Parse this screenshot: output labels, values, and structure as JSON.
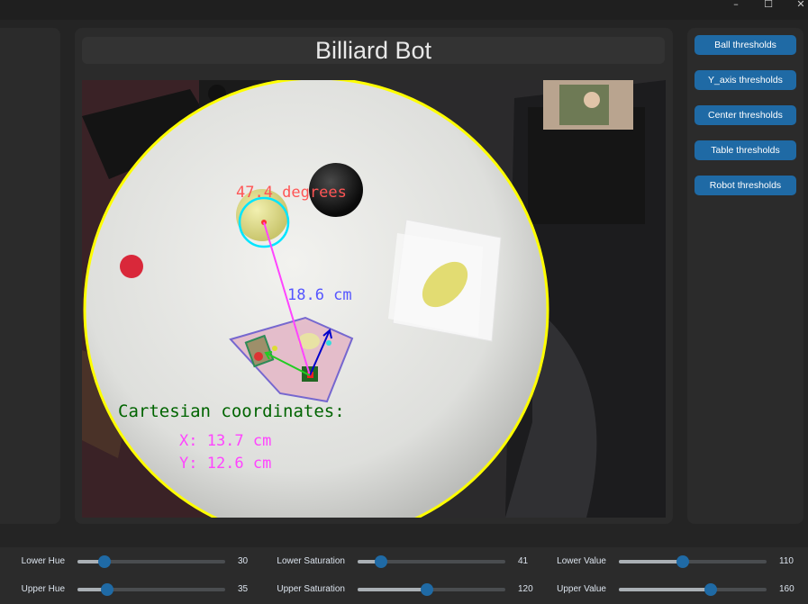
{
  "window": {
    "minimize": "–",
    "maximize": "☐",
    "close": "✕"
  },
  "header": {
    "title": "Billiard Bot"
  },
  "camera": {
    "angle_label": "47.4 degrees",
    "distance_label": "18.6 cm",
    "coords_title": "Cartesian coordinates:",
    "x_label": "X: 13.7 cm",
    "y_label": "Y: 12.6 cm"
  },
  "side_buttons": [
    {
      "label": "Ball thresholds"
    },
    {
      "label": "Y_axis thresholds"
    },
    {
      "label": "Center thresholds"
    },
    {
      "label": "Table thresholds"
    },
    {
      "label": "Robot thresholds"
    }
  ],
  "sliders": [
    {
      "label": "Lower Hue",
      "value": "30",
      "fraction": 0.18
    },
    {
      "label": "Lower Saturation",
      "value": "41",
      "fraction": 0.16
    },
    {
      "label": "Lower Value",
      "value": "110",
      "fraction": 0.43
    },
    {
      "label": "Upper Hue",
      "value": "35",
      "fraction": 0.2
    },
    {
      "label": "Upper Saturation",
      "value": "120",
      "fraction": 0.47
    },
    {
      "label": "Upper Value",
      "value": "160",
      "fraction": 0.62
    }
  ],
  "colors": {
    "accent": "#1f6aa5",
    "annotation_red": "#ff5555",
    "annotation_blue": "#5555ff",
    "annotation_green": "#006400",
    "annotation_magenta": "#ff44ff",
    "table_outline": "#ffff00"
  }
}
